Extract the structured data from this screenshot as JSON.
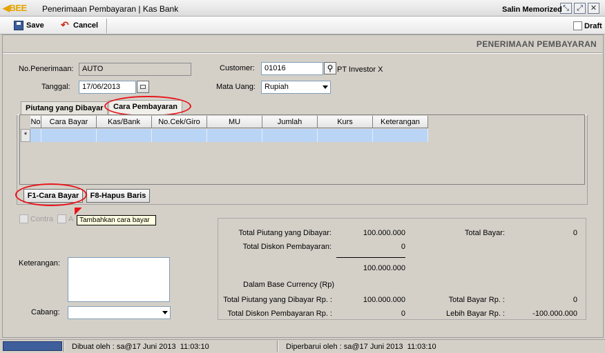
{
  "window": {
    "logo": "BEE",
    "title": "Penerimaan Pembayaran | Kas Bank"
  },
  "toolbar": {
    "save_label": "Save",
    "cancel_label": "Cancel",
    "memorized_label": "Salin Memorized",
    "draft_label": "Draft"
  },
  "page": {
    "heading": "PENERIMAAN PEMBAYARAN"
  },
  "form": {
    "no_penerimaan_label": "No.Penerimaan:",
    "no_penerimaan_value": "AUTO",
    "tanggal_label": "Tanggal:",
    "tanggal_value": "17/06/2013",
    "customer_label": "Customer:",
    "customer_code": "01016",
    "customer_name": "PT Investor X",
    "mata_uang_label": "Mata Uang:",
    "mata_uang_value": "Rupiah"
  },
  "tabs": [
    {
      "label": "Piutang yang Dibayar"
    },
    {
      "label": "Cara Pembayaran"
    }
  ],
  "grid": {
    "columns": [
      "No",
      "Cara Bayar",
      "Kas/Bank",
      "No.Cek/Giro",
      "MU",
      "Jumlah",
      "Kurs",
      "Keterangan"
    ],
    "new_row_marker": "*"
  },
  "buttons": {
    "f1_label": "F1-Cara Bayar",
    "f8_label": "F8-Hapus Baris",
    "tooltip": "Tambahkan cara bayar"
  },
  "options": {
    "contra_label": "Contra",
    "second_label": "A"
  },
  "footer_form": {
    "keterangan_label": "Keterangan:",
    "keterangan_value": "",
    "cabang_label": "Cabang:",
    "cabang_value": ""
  },
  "totals": {
    "total_piutang_label": "Total Piutang yang Dibayar:",
    "total_piutang_value": "100.000.000",
    "total_diskon_label": "Total Diskon Pembayaran:",
    "total_diskon_value": "0",
    "subtotal_value": "100.000.000",
    "total_bayar_label": "Total Bayar:",
    "total_bayar_value": "0",
    "base_currency_label": "Dalam Base Currency (Rp)",
    "total_piutang_rp_label": "Total Piutang yang Dibayar Rp. :",
    "total_piutang_rp_value": "100.000.000",
    "total_diskon_rp_label": "Total Diskon Pembayaran Rp. :",
    "total_diskon_rp_value": "0",
    "total_bayar_rp_label": "Total Bayar Rp. :",
    "total_bayar_rp_value": "0",
    "lebih_bayar_rp_label": "Lebih Bayar Rp. :",
    "lebih_bayar_rp_value": "-100.000.000"
  },
  "status": {
    "created": "Dibuat oleh : sa@17 Juni 2013  11:03:10",
    "updated": "Diperbarui oleh : sa@17 Juni 2013  11:03:10"
  }
}
